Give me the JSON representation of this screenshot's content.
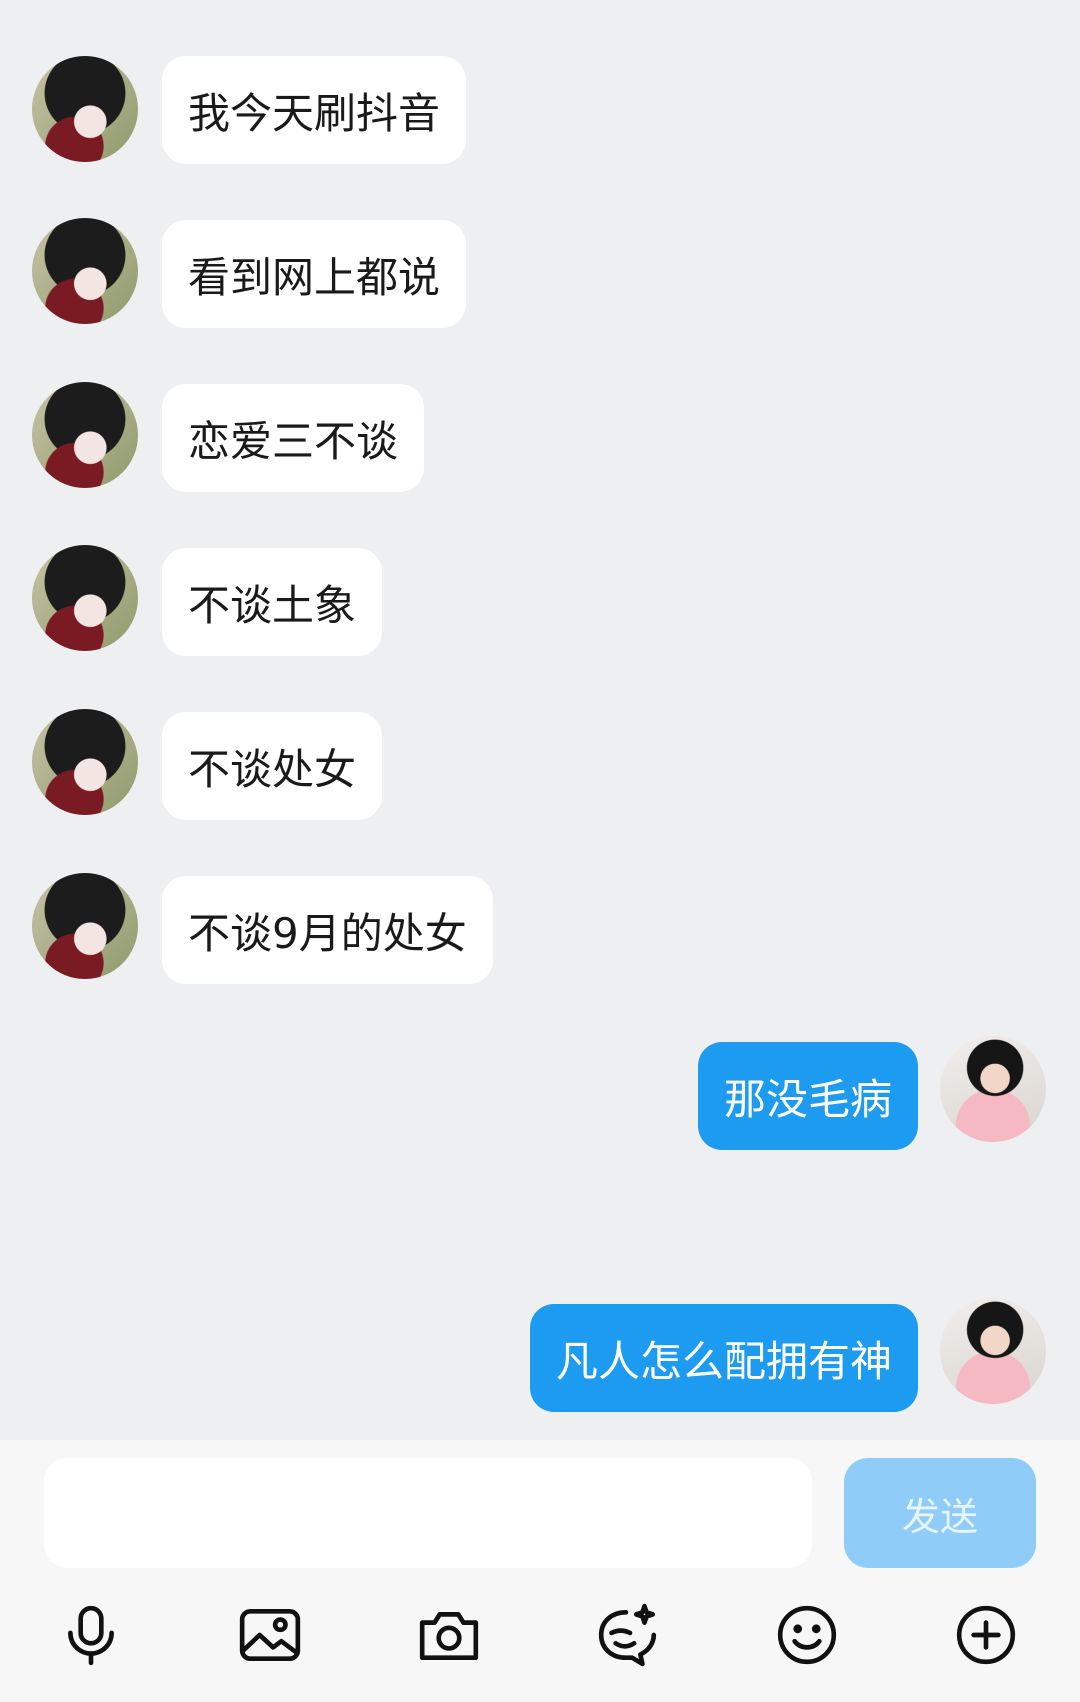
{
  "messages": [
    {
      "side": "left",
      "text": "我今天刷抖音"
    },
    {
      "side": "left",
      "text": "看到网上都说"
    },
    {
      "side": "left",
      "text": "恋爱三不谈"
    },
    {
      "side": "left",
      "text": "不谈土象"
    },
    {
      "side": "left",
      "text": "不谈处女"
    },
    {
      "side": "left",
      "text": "不谈9月的处女"
    },
    {
      "side": "right",
      "text": "那没毛病"
    },
    {
      "side": "right",
      "text": "凡人怎么配拥有神"
    }
  ],
  "composer": {
    "input_value": "",
    "send_label": "发送"
  },
  "toolbar": {
    "icons": [
      "microphone-icon",
      "image-icon",
      "camera-icon",
      "sticker-icon",
      "emoji-icon",
      "plus-icon"
    ]
  },
  "colors": {
    "background": "#eeeff1",
    "incoming_bubble": "#ffffff",
    "outgoing_bubble": "#1d9bf0",
    "send_button": "#8fcdf8"
  }
}
